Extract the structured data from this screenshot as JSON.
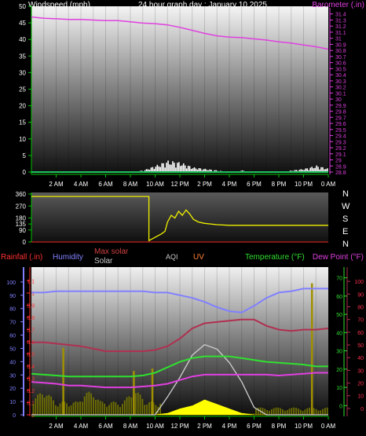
{
  "header": {
    "title": "24 hour graph day : January 10 2025",
    "left_label": "Windspeed (mph)",
    "right_label": "Barometer (.in)"
  },
  "time_axis": [
    "2 AM",
    "4 AM",
    "6 AM",
    "8 AM",
    "10 AM",
    "12 PM",
    "2 PM",
    "4 PM",
    "6 PM",
    "8 PM",
    "10 PM",
    "0 AM"
  ],
  "direction_labels": [
    "N",
    "W",
    "S",
    "E",
    "N"
  ],
  "legend": {
    "rainfall": "Rainfall (.in)",
    "humidity": "Humidity",
    "max_solar": "Max solar",
    "solar": "Solar",
    "aqi": "AQI",
    "uv": "UV",
    "temperature": "Temperature (°F)",
    "dewpoint": "Dew Point (°F)"
  },
  "colors": {
    "windspeed": "#ffffff",
    "barometer": "#e040e0",
    "direction": "#f0f000",
    "rainfall": "#ff3030",
    "humidity": "#8080ff",
    "max_solar": "#d0d0d0",
    "solar": "#ffff00",
    "temperature": "#30e030",
    "dewpoint": "#b03050",
    "axis_green": "#00c000"
  },
  "chart_data": [
    {
      "type": "line",
      "name": "wind-barometer",
      "x_hours": [
        0,
        1,
        2,
        3,
        4,
        5,
        6,
        7,
        8,
        9,
        10,
        11,
        12,
        13,
        14,
        15,
        16,
        17,
        18,
        19,
        20,
        21,
        22,
        23,
        24
      ],
      "series": [
        {
          "name": "Barometer (.in)",
          "axis": "right",
          "values": [
            31.35,
            31.33,
            31.32,
            31.31,
            31.31,
            31.3,
            31.29,
            31.29,
            31.27,
            31.25,
            31.24,
            31.22,
            31.18,
            31.13,
            31.08,
            31.04,
            31.02,
            31.01,
            30.99,
            30.97,
            30.94,
            30.92,
            30.89,
            30.86,
            30.82
          ]
        },
        {
          "name": "Windspeed (mph)",
          "axis": "left",
          "values": [
            0,
            0,
            0,
            0,
            0,
            0,
            0,
            0,
            0,
            0.5,
            2,
            3.5,
            3,
            1.5,
            1,
            0.5,
            0,
            0.5,
            0,
            0,
            0,
            0.5,
            1,
            2,
            1
          ]
        }
      ],
      "left_axis": {
        "ylim": [
          0,
          50
        ],
        "ticks": [
          0,
          5,
          10,
          15,
          20,
          25,
          30,
          35,
          40,
          45,
          50
        ]
      },
      "right_axis": {
        "ylim": [
          28.8,
          31.5
        ],
        "ticks": [
          "28.8",
          "28.9",
          "29",
          "29.1",
          "29.2",
          "29.3",
          "29.4",
          "29.5",
          "29.6",
          "29.7",
          "29.8",
          "29.9",
          "30",
          "30.1",
          "30.2",
          "30.3",
          "30.4",
          "30.5",
          "30.6",
          "30.7",
          "30.8",
          "30.9",
          "31",
          "31.1",
          "31.2",
          "31.3",
          "31.4"
        ]
      }
    },
    {
      "type": "line",
      "name": "wind-direction",
      "ylim": [
        0,
        360
      ],
      "ticks": [
        "360",
        "270",
        "180",
        "135",
        "90",
        "0"
      ],
      "x_hours": [
        0,
        9.5,
        9.5,
        10.5,
        10.8,
        11,
        11.3,
        11.6,
        11.9,
        12.2,
        12.5,
        12.8,
        13.1,
        13.5,
        14,
        15,
        16,
        18,
        20,
        22,
        24
      ],
      "values": [
        342,
        342,
        10,
        60,
        80,
        150,
        200,
        180,
        230,
        200,
        240,
        210,
        170,
        150,
        140,
        130,
        125,
        125,
        125,
        125,
        125
      ]
    },
    {
      "type": "line",
      "name": "weather-multi",
      "x_hours": [
        0,
        1,
        2,
        3,
        4,
        5,
        6,
        7,
        8,
        9,
        10,
        11,
        12,
        13,
        14,
        15,
        16,
        17,
        18,
        19,
        20,
        21,
        22,
        23,
        24
      ],
      "series": [
        {
          "name": "Humidity",
          "axis": "humidity",
          "values": [
            92,
            92,
            93,
            93,
            93,
            93,
            93,
            93,
            93,
            93,
            92,
            92,
            90,
            88,
            85,
            81,
            78,
            77,
            82,
            88,
            92,
            93,
            95,
            95,
            95
          ]
        },
        {
          "name": "Dew Point (°F)",
          "axis": "dewpoint",
          "values": [
            52,
            52,
            51,
            50,
            49,
            47,
            45,
            45,
            45,
            45,
            46,
            49,
            55,
            63,
            67,
            68,
            69,
            70,
            70,
            65,
            62,
            61,
            62,
            62,
            63
          ]
        },
        {
          "name": "Temperature (°F)",
          "axis": "temperature",
          "values": [
            17.5,
            17,
            16.5,
            16,
            16,
            16,
            16,
            16,
            16,
            16.5,
            18,
            21,
            24,
            26,
            27,
            27,
            27,
            26,
            25,
            24,
            23.5,
            23,
            22.5,
            21.5,
            21.5
          ]
        },
        {
          "name": "",
          "axis": "temperature",
          "values": [
            13,
            12.5,
            12,
            11,
            11,
            10.5,
            10,
            10,
            10,
            10.5,
            11,
            12,
            14,
            16,
            17,
            17,
            17,
            17,
            17,
            17,
            16.5,
            17,
            17.5,
            18,
            18
          ]
        },
        {
          "name": "Max solar",
          "axis": "solar",
          "values": [
            0,
            0,
            0,
            0,
            0,
            0,
            0,
            0,
            0,
            0,
            0,
            12,
            25,
            40,
            47,
            44,
            35,
            22,
            5,
            0,
            0,
            0,
            0,
            0,
            0
          ]
        },
        {
          "name": "Solar",
          "axis": "solar",
          "values": [
            0,
            0,
            0,
            0,
            0,
            0,
            0,
            0,
            0,
            0,
            0,
            1,
            4,
            6,
            10,
            7,
            4,
            1,
            0,
            0,
            0,
            0,
            0,
            0,
            0
          ]
        }
      ],
      "axes": {
        "rainfall": {
          "ylim": [
            0,
            1.2
          ],
          "ticks": [
            "0",
            "0.1",
            "0.2",
            "0.3",
            "0.4",
            "0.5",
            "0.6",
            "0.7",
            "0.8",
            "0.9",
            "1",
            "1.1"
          ]
        },
        "humidity": {
          "ylim": [
            0,
            110
          ],
          "ticks": [
            "0",
            "10",
            "20",
            "30",
            "40",
            "50",
            "60",
            "70",
            "80",
            "90",
            "100"
          ]
        },
        "temperature": {
          "ylim": [
            -5,
            75
          ],
          "ticks": [
            "0",
            "10",
            "20",
            "30",
            "40",
            "50",
            "60",
            "70"
          ]
        },
        "dewpoint": {
          "ylim": [
            -5,
            110
          ],
          "ticks": [
            "0",
            "10",
            "20",
            "30",
            "40",
            "50",
            "60",
            "70",
            "80",
            "90",
            "100"
          ]
        }
      }
    }
  ]
}
